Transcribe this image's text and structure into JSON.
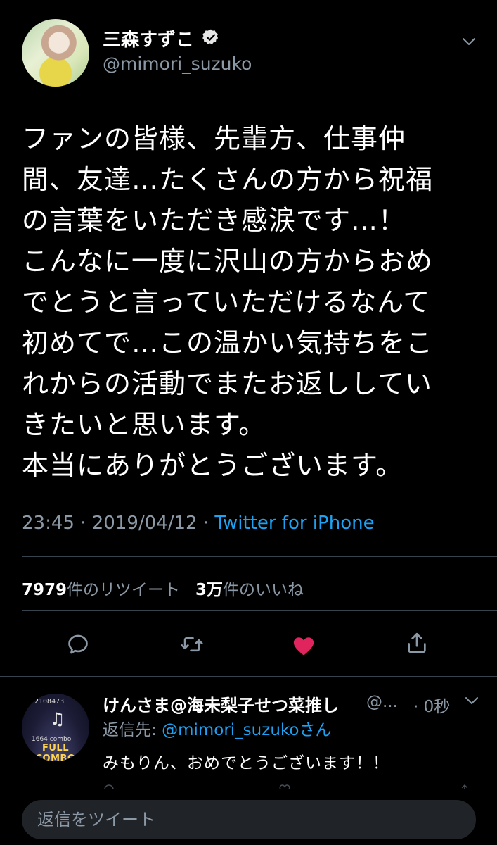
{
  "tweet": {
    "author_name": "三森すずこ",
    "author_handle": "@mimori_suzuko",
    "verified_icon": "verified-badge-icon",
    "text": "ファンの皆様、先輩方、仕事仲\n間、友達…たくさんの方から祝福\nの言葉をいただき感涙です…！\nこんなに一度に沢山の方からおめ\nでとうと言っていただけるなんて\n初めてで…この温かい気持ちをこ\nれからの活動でまたお返ししてい\nきたいと思います。\n本当にありがとうございます。",
    "time": "23:45",
    "date": "2019/04/12",
    "separator": " · ",
    "source": "Twitter for iPhone"
  },
  "stats": {
    "retweet_count": "7979",
    "retweet_label": "件のリツイート",
    "like_count": "3万",
    "like_label": "件のいいね"
  },
  "actions": {
    "reply_icon": "reply-icon",
    "retweet_icon": "retweet-icon",
    "like_icon": "heart-icon",
    "like_color": "#e0245e",
    "share_icon": "share-icon"
  },
  "reply": {
    "author_name": "けんさま@海未梨子せつ菜推し",
    "author_handle": "@...",
    "time": "· 0秒",
    "reply_to_prefix": "返信先: ",
    "reply_to_handle": "@mimori_suzuko",
    "reply_to_suffix": "さん",
    "text": "みもりん、おめでとうございます！！",
    "avatar_score": "2108473",
    "avatar_combo": "1664 combo",
    "avatar_banner": "FULL COMBO"
  },
  "compose": {
    "placeholder": "返信をツイート"
  },
  "colors": {
    "background": "#000000",
    "text": "#ffffff",
    "secondary_text": "#8b98a5",
    "link": "#1da1f2",
    "divider": "#38444d",
    "compose_bg": "#202327"
  }
}
